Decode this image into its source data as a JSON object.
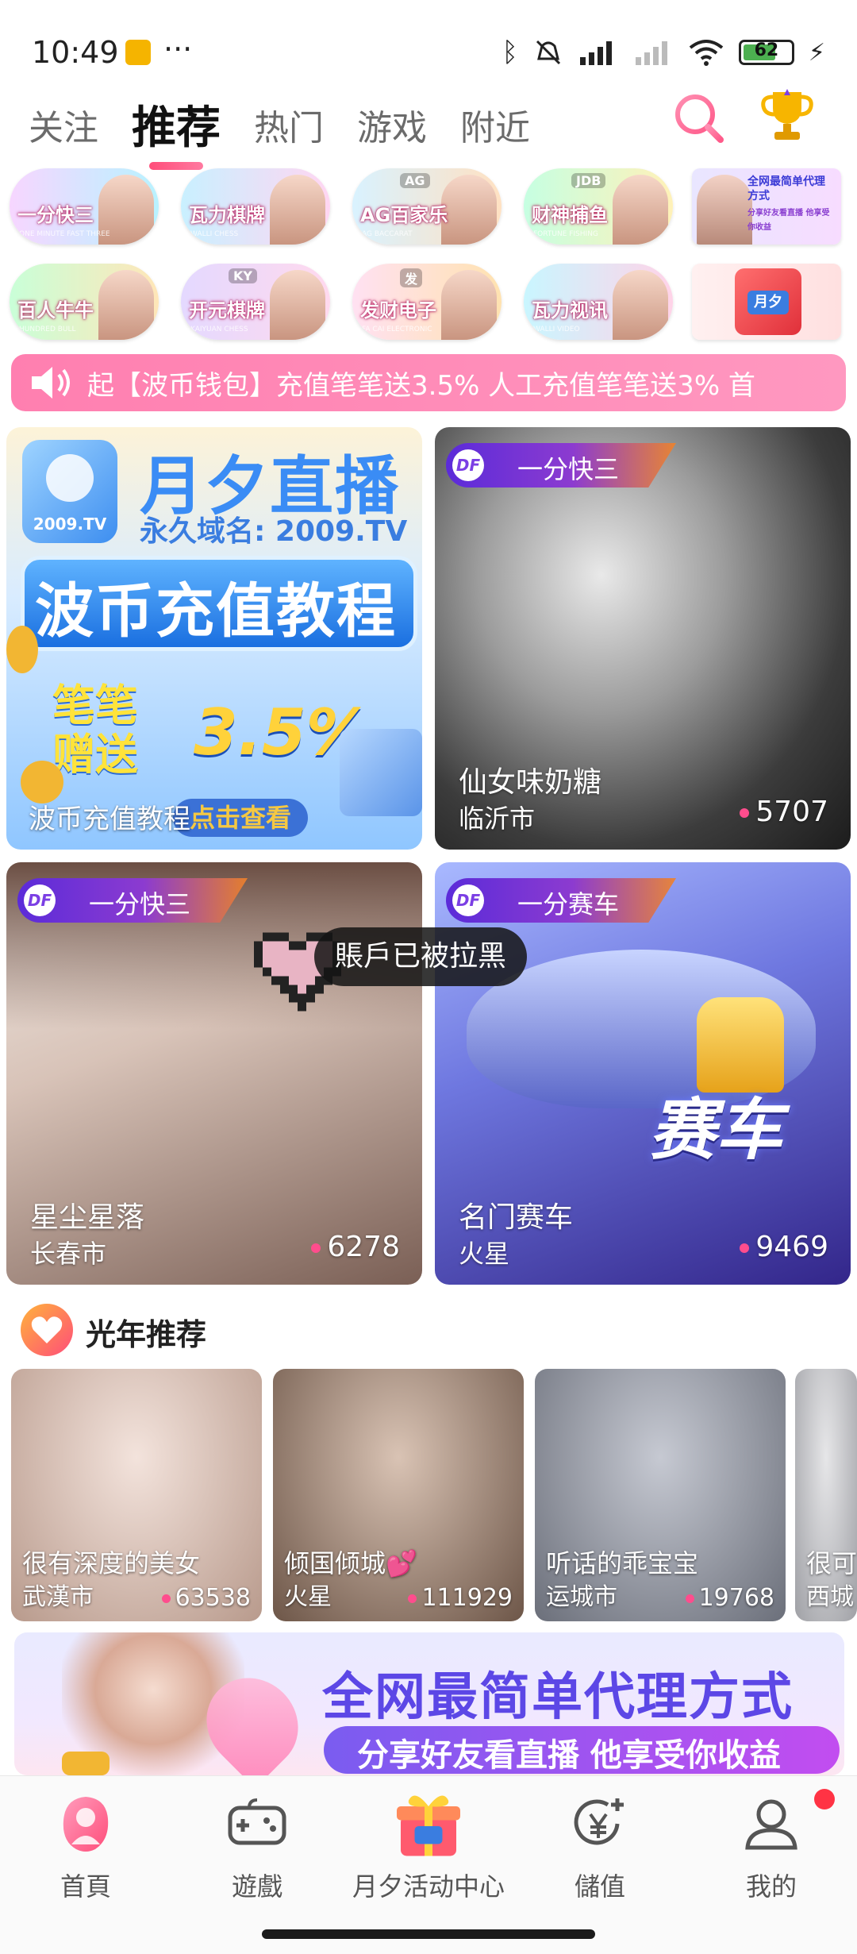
{
  "status_bar": {
    "time": "10:49",
    "dots": "···",
    "battery": "62"
  },
  "tabs": [
    "关注",
    "推荐",
    "热门",
    "游戏",
    "附近"
  ],
  "game_grid": [
    {
      "label": "一分快三",
      "sub": "ONE MINUTE FAST THREE",
      "colors": [
        "#f7d6ff",
        "#b8f2ff"
      ]
    },
    {
      "label": "瓦力棋牌",
      "sub": "WALLI CHESS",
      "colors": [
        "#c9f0ff",
        "#ffd6f2"
      ]
    },
    {
      "label": "AG百家乐",
      "sub": "AG BACCARAT",
      "logo": "AG",
      "colors": [
        "#d9f2ff",
        "#ffe1c2"
      ]
    },
    {
      "label": "财神捕鱼",
      "sub": "FORTUNE FISHING",
      "logo": "JDB",
      "colors": [
        "#c6ffe2",
        "#fff1b8"
      ]
    },
    {
      "label": "全网最简单代理方式",
      "sub": "分享好友看直播 他享受你收益",
      "promo": true,
      "colors": [
        "#e9e6ff",
        "#f7dcff"
      ]
    },
    {
      "label": "百人牛牛",
      "sub": "HUNDRED BULL",
      "colors": [
        "#c9ffd8",
        "#ffe6b8"
      ]
    },
    {
      "label": "开元棋牌",
      "sub": "KAIYUAN CHESS",
      "logo": "KY",
      "colors": [
        "#e4d9ff",
        "#ffd9ee"
      ]
    },
    {
      "label": "发财电子",
      "sub": "FA CAI ELECTRONIC",
      "logo": "发",
      "colors": [
        "#ffe1f2",
        "#ffe2b0"
      ]
    },
    {
      "label": "瓦力视讯",
      "sub": "WALLI VIDEO",
      "colors": [
        "#c9f6ff",
        "#ffd3e8"
      ]
    },
    {
      "label": "月夕",
      "sub": "",
      "promo_gift": true,
      "colors": [
        "#fff0f0",
        "#ffe0e0"
      ]
    }
  ],
  "marquee": {
    "text": "起【波币钱包】充值笔笔送3.5% 人工充值笔笔送3% 首"
  },
  "cards": [
    {
      "type": "banner",
      "logo": "2009.TV",
      "title": "月夕直播",
      "domain": "永久域名: 2009.TV",
      "headline": "波币充值教程",
      "gift": "笔笔赠送",
      "percent": "3.5%",
      "button": "点击查看",
      "caption": "波币充值教程"
    },
    {
      "tag": "一分快三",
      "tag_logo": "DF",
      "name": "仙女味奶糖",
      "city": "临沂市",
      "count": "5707",
      "colors": [
        "#3a3a3a",
        "#8a8a8a"
      ]
    },
    {
      "tag": "一分快三",
      "tag_logo": "DF",
      "name": "星尘星落",
      "city": "长春市",
      "count": "6278",
      "colors": [
        "#e8ddd6",
        "#8a6f66"
      ]
    },
    {
      "tag": "一分赛车",
      "tag_logo": "DF",
      "name": "名门赛车",
      "city": "火星",
      "count": "9469",
      "art_text": "赛车",
      "colors": [
        "#8fa2f5",
        "#3b2d8a"
      ]
    }
  ],
  "toast": "賬戶已被拉黑",
  "section": {
    "title": "光年推荐"
  },
  "recommend": [
    {
      "name": "很有深度的美女",
      "city": "武漢市",
      "count": "63538",
      "colors": [
        "#f3e3dc",
        "#b89a8c"
      ]
    },
    {
      "name": "倾国倾城💕",
      "city": "火星",
      "count": "111929",
      "colors": [
        "#d9c3b4",
        "#6d5648"
      ]
    },
    {
      "name": "听话的乖宝宝",
      "city": "运城市",
      "count": "19768",
      "colors": [
        "#c6c9d2",
        "#6b6f7a"
      ]
    },
    {
      "name": "很可",
      "city": "西城",
      "count": "",
      "colors": [
        "#e6e6e8",
        "#9fa0a5"
      ]
    }
  ],
  "big_banner": {
    "title": "全网最简单代理方式",
    "subtitle": "分享好友看直播 他享受你收益"
  },
  "bottom_nav": [
    {
      "label": "首頁",
      "icon": "home-icon",
      "active": true
    },
    {
      "label": "遊戲",
      "icon": "gamepad-icon"
    },
    {
      "label": "月夕活动中心",
      "icon": "gift-box-icon"
    },
    {
      "label": "儲值",
      "icon": "yen-coin-icon"
    },
    {
      "label": "我的",
      "icon": "profile-icon",
      "badge": true
    }
  ],
  "colors": {
    "accent": "#ff4d7a",
    "marquee_bg": "#ff8bb8",
    "tag_purple": "#6a2fd8",
    "nav_active": "#ff4d7a"
  }
}
